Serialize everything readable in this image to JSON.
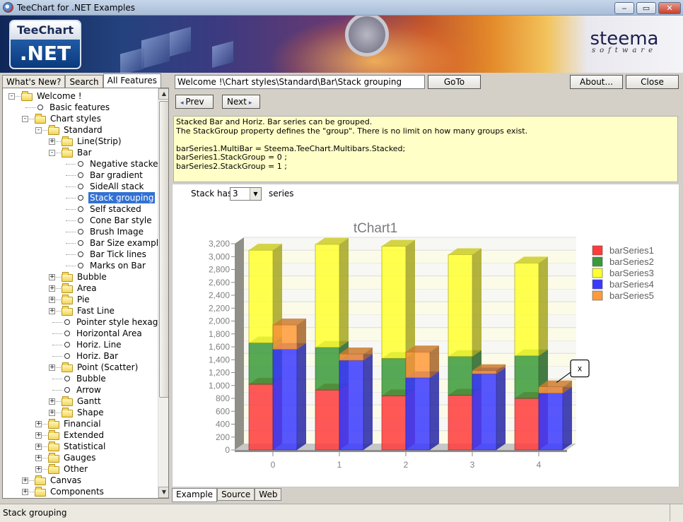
{
  "window": {
    "title": "TeeChart for .NET Examples",
    "min": "‒",
    "max": "▭",
    "close": "✕"
  },
  "banner": {
    "logo_top": "TeeChart",
    "logo_bottom": ".NET",
    "brand": "steema",
    "brand_sub": "software"
  },
  "left_tabs": [
    "What's New?",
    "Search",
    "All Features"
  ],
  "tree": [
    {
      "label": "Welcome !",
      "level": 0,
      "type": "folder",
      "exp": "-"
    },
    {
      "label": "Basic features",
      "level": 1,
      "type": "leaf"
    },
    {
      "label": "Chart styles",
      "level": 1,
      "type": "folder",
      "exp": "-"
    },
    {
      "label": "Standard",
      "level": 2,
      "type": "folder",
      "exp": "-"
    },
    {
      "label": "Line(Strip)",
      "level": 3,
      "type": "folder",
      "exp": "+"
    },
    {
      "label": "Bar",
      "level": 3,
      "type": "folder",
      "exp": "-"
    },
    {
      "label": "Negative stacked",
      "level": 4,
      "type": "leaf"
    },
    {
      "label": "Bar gradient",
      "level": 4,
      "type": "leaf"
    },
    {
      "label": "SideAll stack",
      "level": 4,
      "type": "leaf"
    },
    {
      "label": "Stack grouping",
      "level": 4,
      "type": "leaf",
      "selected": true
    },
    {
      "label": "Self stacked",
      "level": 4,
      "type": "leaf"
    },
    {
      "label": "Cone Bar style",
      "level": 4,
      "type": "leaf"
    },
    {
      "label": "Brush Image",
      "level": 4,
      "type": "leaf"
    },
    {
      "label": "Bar Size example",
      "level": 4,
      "type": "leaf"
    },
    {
      "label": "Bar Tick lines",
      "level": 4,
      "type": "leaf"
    },
    {
      "label": "Marks on Bar",
      "level": 4,
      "type": "leaf"
    },
    {
      "label": "Bubble",
      "level": 3,
      "type": "folder",
      "exp": "+"
    },
    {
      "label": "Area",
      "level": 3,
      "type": "folder",
      "exp": "+"
    },
    {
      "label": "Pie",
      "level": 3,
      "type": "folder",
      "exp": "+"
    },
    {
      "label": "Fast Line",
      "level": 3,
      "type": "folder",
      "exp": "+"
    },
    {
      "label": "Pointer style hexagon",
      "level": 3,
      "type": "leaf"
    },
    {
      "label": "Horizontal Area",
      "level": 3,
      "type": "leaf"
    },
    {
      "label": "Horiz. Line",
      "level": 3,
      "type": "leaf"
    },
    {
      "label": "Horiz. Bar",
      "level": 3,
      "type": "leaf"
    },
    {
      "label": "Point (Scatter)",
      "level": 3,
      "type": "folder",
      "exp": "+"
    },
    {
      "label": "Bubble",
      "level": 3,
      "type": "leaf"
    },
    {
      "label": "Arrow",
      "level": 3,
      "type": "leaf"
    },
    {
      "label": "Gantt",
      "level": 3,
      "type": "folder",
      "exp": "+"
    },
    {
      "label": "Shape",
      "level": 3,
      "type": "folder",
      "exp": "+"
    },
    {
      "label": "Financial",
      "level": 2,
      "type": "folder",
      "exp": "+"
    },
    {
      "label": "Extended",
      "level": 2,
      "type": "folder",
      "exp": "+"
    },
    {
      "label": "Statistical",
      "level": 2,
      "type": "folder",
      "exp": "+"
    },
    {
      "label": "Gauges",
      "level": 2,
      "type": "folder",
      "exp": "+"
    },
    {
      "label": "Other",
      "level": 2,
      "type": "folder",
      "exp": "+"
    },
    {
      "label": "Canvas",
      "level": 1,
      "type": "folder",
      "exp": "+"
    },
    {
      "label": "Components",
      "level": 1,
      "type": "folder",
      "exp": "+"
    }
  ],
  "toolbar": {
    "path": "Welcome !\\Chart styles\\Standard\\Bar\\Stack grouping",
    "goto": "GoTo",
    "about": "About...",
    "close": "Close",
    "prev": "Prev",
    "next": "Next"
  },
  "description": "Stacked Bar and Horiz. Bar series can be grouped.\nThe StackGroup property defines the \"group\". There is no limit on how many groups exist.\n\nbarSeries1.MultiBar = Steema.TeeChart.Multibars.Stacked;\nbarSeries1.StackGroup = 0 ;\nbarSeries2.StackGroup = 1 ;",
  "stack": {
    "label": "Stack has",
    "value": "3",
    "suffix": "series"
  },
  "chart_data": {
    "type": "bar",
    "title": "tChart1",
    "stacked": true,
    "categories": [
      "0",
      "1",
      "2",
      "3",
      "4"
    ],
    "ylim": [
      0,
      3200
    ],
    "yticks": [
      "0",
      "200",
      "400",
      "600",
      "800",
      "1,000",
      "1,200",
      "1,400",
      "1,600",
      "1,800",
      "2,000",
      "2,200",
      "2,400",
      "2,600",
      "2,800",
      "3,000",
      "3,200"
    ],
    "groups": [
      {
        "stack": 0,
        "series": [
          "barSeries1",
          "barSeries2",
          "barSeries3"
        ]
      },
      {
        "stack": 1,
        "series": [
          "barSeries4",
          "barSeries5"
        ]
      }
    ],
    "series": [
      {
        "name": "barSeries1",
        "color": "#ff3b3b",
        "values": [
          1020,
          930,
          840,
          850,
          800
        ]
      },
      {
        "name": "barSeries2",
        "color": "#3a9a3a",
        "values": [
          640,
          660,
          580,
          600,
          660
        ]
      },
      {
        "name": "barSeries3",
        "color": "#ffff30",
        "values": [
          1440,
          1600,
          1740,
          1580,
          1440
        ]
      },
      {
        "name": "barSeries4",
        "color": "#3a3aff",
        "values": [
          1560,
          1390,
          1120,
          1180,
          880
        ]
      },
      {
        "name": "barSeries5",
        "color": "#ff9a3a",
        "values": [
          380,
          100,
          400,
          50,
          100
        ]
      }
    ],
    "legend_position": "right",
    "grid": true,
    "annotation": "x"
  },
  "bottom_tabs": [
    "Example",
    "Source",
    "Web"
  ],
  "status": "Stack grouping"
}
